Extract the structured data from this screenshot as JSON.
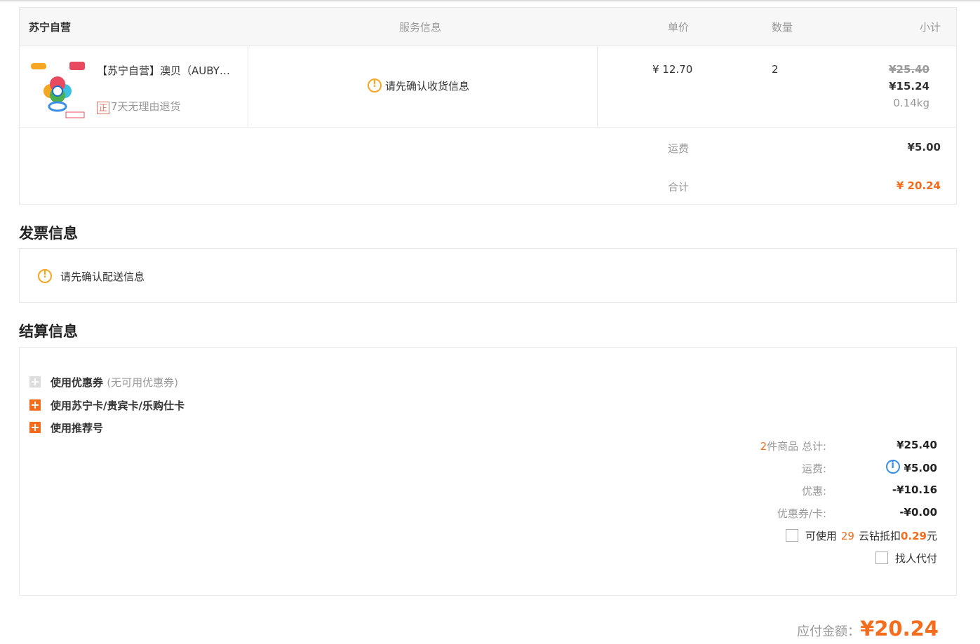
{
  "order": {
    "headers": {
      "shop": "苏宁自营",
      "service": "服务信息",
      "unit_price": "单价",
      "quantity": "数量",
      "subtotal": "小计"
    },
    "product": {
      "title": "【苏宁自营】澳贝（AUBY…",
      "return_policy_icon_text": "正",
      "return_policy": "7天无理由退货",
      "service_msg": "请先确认收货信息",
      "unit_price": "¥ 12.70",
      "quantity": "2",
      "original_subtotal": "¥25.40",
      "subtotal": "¥15.24",
      "weight": "0.14kg"
    },
    "shipping_label": "运费",
    "shipping_value": "¥5.00",
    "total_label": "合计",
    "total_value": "¥ 20.24"
  },
  "invoice": {
    "title": "发票信息",
    "message": "请先确认配送信息"
  },
  "settlement": {
    "title": "结算信息",
    "options": {
      "coupon_label": "使用优惠券",
      "coupon_note": "(无可用优惠券)",
      "card_label": "使用苏宁卡/贵宾卡/乐购仕卡",
      "referral_label": "使用推荐号"
    },
    "summary": {
      "count": "2",
      "count_label": "件商品 总计:",
      "goods_total": "¥25.40",
      "shipping_label": "运费:",
      "shipping": "¥5.00",
      "discount_label": "优惠:",
      "discount": "-¥10.16",
      "coupon_card_label": "优惠券/卡:",
      "coupon_card": "-¥0.00"
    },
    "yunzuan": {
      "prefix": "可使用",
      "count": "29",
      "middle": "云钻抵扣",
      "amount": "0.29",
      "suffix": "元"
    },
    "pay_for_me": "找人代付"
  },
  "payable": {
    "label": "应付金额：",
    "amount": "¥20.24"
  },
  "colors": {
    "accent": "#f56c1c",
    "warning": "#f5a623",
    "info": "#3a8ee6"
  }
}
